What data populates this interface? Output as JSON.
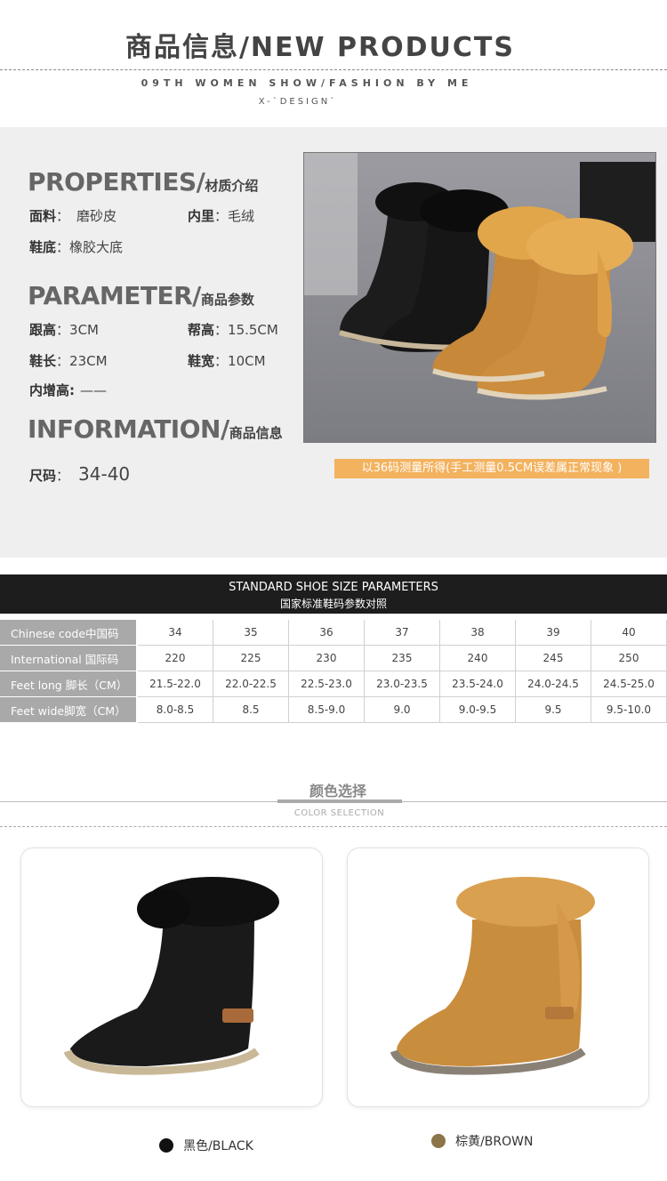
{
  "header": {
    "title": "商品信息/NEW PRODUCTS",
    "subtitle1": "09TH WOMEN SHOW/FASHION BY ME",
    "subtitle2": "X-`DESIGN`"
  },
  "properties": {
    "heading": "PROPERTIES/",
    "heading_cn": "材质介绍",
    "material_label": "面料",
    "material_value": "磨砂皮",
    "lining_label": "内里",
    "lining_value": "毛绒",
    "sole_label": "鞋底",
    "sole_value": "橡胶大底"
  },
  "parameter": {
    "heading": "PARAMETER/",
    "heading_cn": "商品参数",
    "heel_label": "跟高",
    "heel_value": "3CM",
    "shaft_label": "帮高",
    "shaft_value": "15.5CM",
    "length_label": "鞋长",
    "length_value": "23CM",
    "width_label": "鞋宽",
    "width_value": "10CM",
    "inner_label": "内增高:",
    "inner_value": "——"
  },
  "information": {
    "heading": "INFORMATION/",
    "heading_cn": "商品信息",
    "size_label": "尺码",
    "size_value": "34-40"
  },
  "note": "以36码测量所得(手工测量0.5CM误差属正常现象 )",
  "size_table": {
    "title_en": "STANDARD SHOE SIZE PARAMETERS",
    "title_cn": "国家标准鞋码参数对照",
    "rows": [
      {
        "label": "Chinese code中国码",
        "values": [
          "34",
          "35",
          "36",
          "37",
          "38",
          "39",
          "40"
        ]
      },
      {
        "label": "International 国际码",
        "values": [
          "220",
          "225",
          "230",
          "235",
          "240",
          "245",
          "250"
        ]
      },
      {
        "label": "Feet long 脚长（CM）",
        "values": [
          "21.5-22.0",
          "22.0-22.5",
          "22.5-23.0",
          "23.0-23.5",
          "23.5-24.0",
          "24.0-24.5",
          "24.5-25.0"
        ]
      },
      {
        "label": "Feet wide脚宽（CM）",
        "values": [
          "8.0-8.5",
          "8.5",
          "8.5-9.0",
          "9.0",
          "9.0-9.5",
          "9.5",
          "9.5-10.0"
        ]
      }
    ]
  },
  "color_selection": {
    "title": "颜色选择",
    "subtitle": "COLOR SELECTION",
    "options": [
      {
        "label": "黑色/BLACK",
        "color": "#111111"
      },
      {
        "label": "棕黄/BROWN",
        "color": "#8c7448"
      }
    ]
  },
  "colors": {
    "panel_bg": "#efefef",
    "note_bg": "#f3b25e",
    "table_header_bg": "#1d1d1d",
    "table_label_bg": "#a9a9a9",
    "boot_black": "#1a1a1a",
    "boot_tan": "#c98d3e"
  }
}
